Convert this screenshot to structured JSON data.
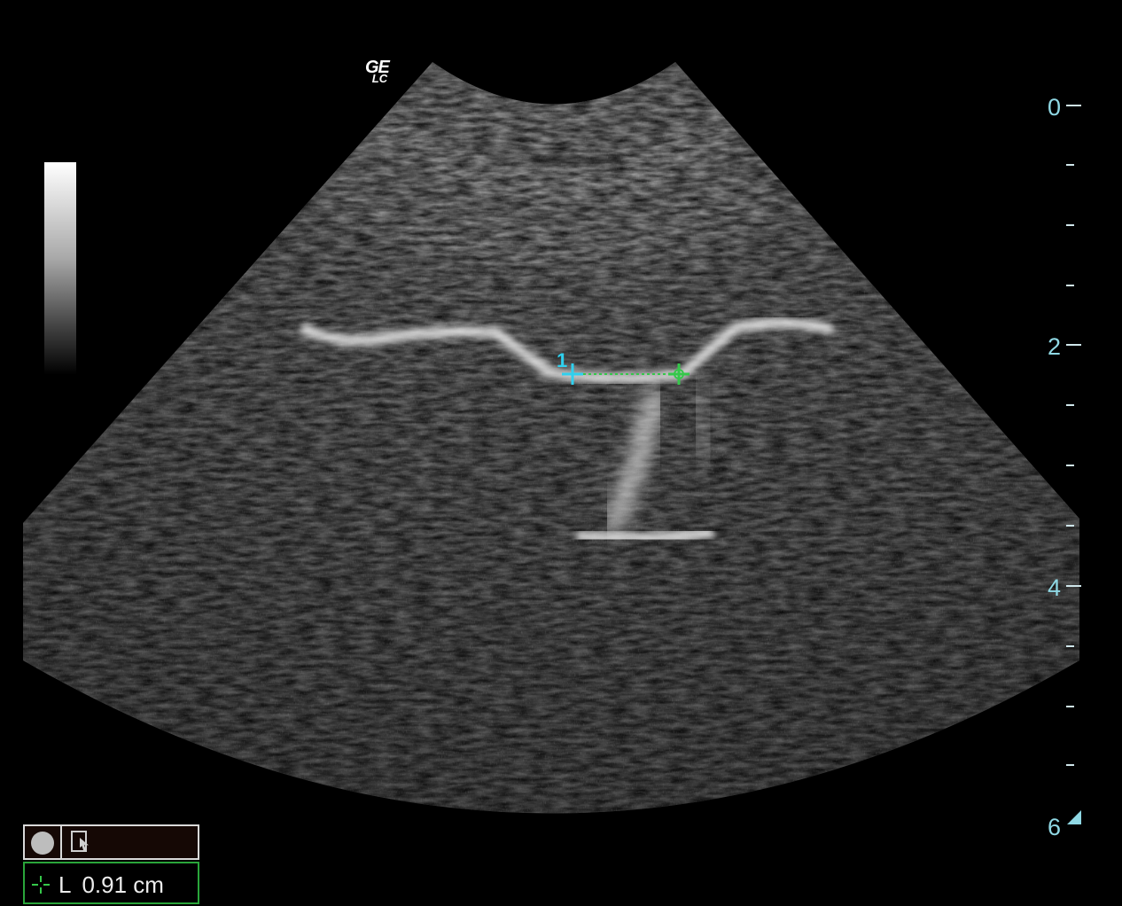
{
  "display": {
    "logo_text": "GE",
    "logo_subtext": "LC",
    "depth_scale": {
      "labels": [
        "0",
        "2",
        "4",
        "6"
      ],
      "unit": "cm"
    },
    "caliper": {
      "label": "1",
      "color": "#2fd0ee",
      "end_color": "#35c84a"
    },
    "grayscale_bar": true
  },
  "status_panel": {
    "circle_icon": "record-circle-icon",
    "pointer_icon": "pointer-hand-icon"
  },
  "measurement": {
    "icon": "caliper-crosshair-icon",
    "type_label": "L",
    "value": "0.91 cm"
  }
}
